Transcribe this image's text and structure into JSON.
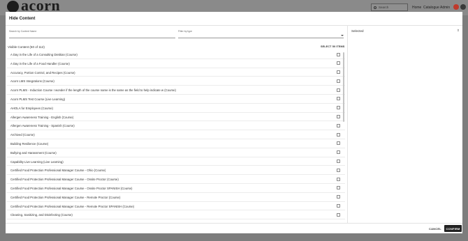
{
  "app": {
    "logo_text": "acorn",
    "search_placeholder": "Search",
    "nav": [
      "Home",
      "Catalogue",
      "Admin"
    ]
  },
  "modal": {
    "title": "Hide Content",
    "search_label": "Search by Content Name",
    "filter_label": "Filter by type",
    "visible_count": "Visible Content (50 of 112)",
    "select_all": "SELECT 50 ITEMS",
    "selected_label": "Selected",
    "items": [
      "A Day in the Life of a Consulting Dietitian (Course)",
      "A Day in the Life of a Food Handler (Course)",
      "Accuracy, Portion Control, and Recipes (Course)",
      "Acorn LMS Integrations (Course)",
      "Acorn PLMS - Induction Course I wonder if the length of the course name is the same as the field to help indicate w (Course)",
      "Acorn PLMS Test Course (Live Learning)",
      "AHOLA for Employees (Course)",
      "Allergen Awareness Training - English (Course)",
      "Allergen Awareness Training - Spanish (Course)",
      "Archived (Course)",
      "Building Resilience (Course)",
      "Bullying and Harassment (Course)",
      "Capability Live Learning (Live Learning)",
      "Certified Food Protection Professional Manager Course - Ohio (Course)",
      "Certified Food Protection Professional Manager Course - Onsite Proctor (Course)",
      "Certified Food Protection Professional Manager Course - Onsite Proctor SPANISH (Course)",
      "Certified Food Protection Professional Manager Course - Remote Proctor (Course)",
      "Certified Food Protection Professional Manager Course - Remote Proctor SPANISH (Course)",
      "Cleaning, Sanitizing, and Disinfecting (Course)"
    ],
    "cancel_label": "CANCEL",
    "confirm_label": "CONFIRM"
  },
  "icons": {
    "search": "search-icon",
    "expand": "chevron-down-icon",
    "selected_toggle": "sort-icon"
  },
  "colors": {
    "overlay": "#7d7d7d",
    "confirm_bg": "#222222",
    "avatar_red": "#c0392b"
  }
}
